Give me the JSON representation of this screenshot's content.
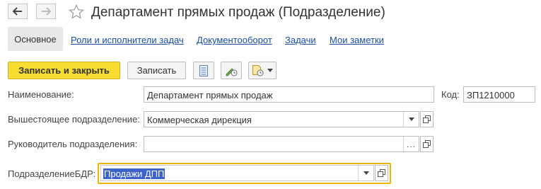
{
  "window": {
    "title": "Департамент прямых продаж (Подразделение)"
  },
  "tabs": [
    {
      "label": "Основное"
    },
    {
      "label": "Роли и исполнители задач"
    },
    {
      "label": "Документооборот"
    },
    {
      "label": "Задачи"
    },
    {
      "label": "Мои заметки"
    }
  ],
  "toolbar": {
    "save_close_label": "Записать и закрыть",
    "save_label": "Записать"
  },
  "form": {
    "name_label": "Наименование:",
    "name_value": "Департамент прямых продаж",
    "code_label": "Код:",
    "code_value": "ЗП1210000",
    "parent_label": "Вышестоящее подразделение:",
    "parent_value": "Коммерческая дирекция",
    "head_label": "Руководитель подразделения:",
    "head_value": "",
    "bdr_label": "ПодразделениеБДР:",
    "bdr_value": "Продажи ДПП"
  },
  "colors": {
    "primary_button": "#f8dc32",
    "link": "#1a4fa0",
    "focus_border": "#e8b800",
    "selection": "#3b63c9"
  }
}
